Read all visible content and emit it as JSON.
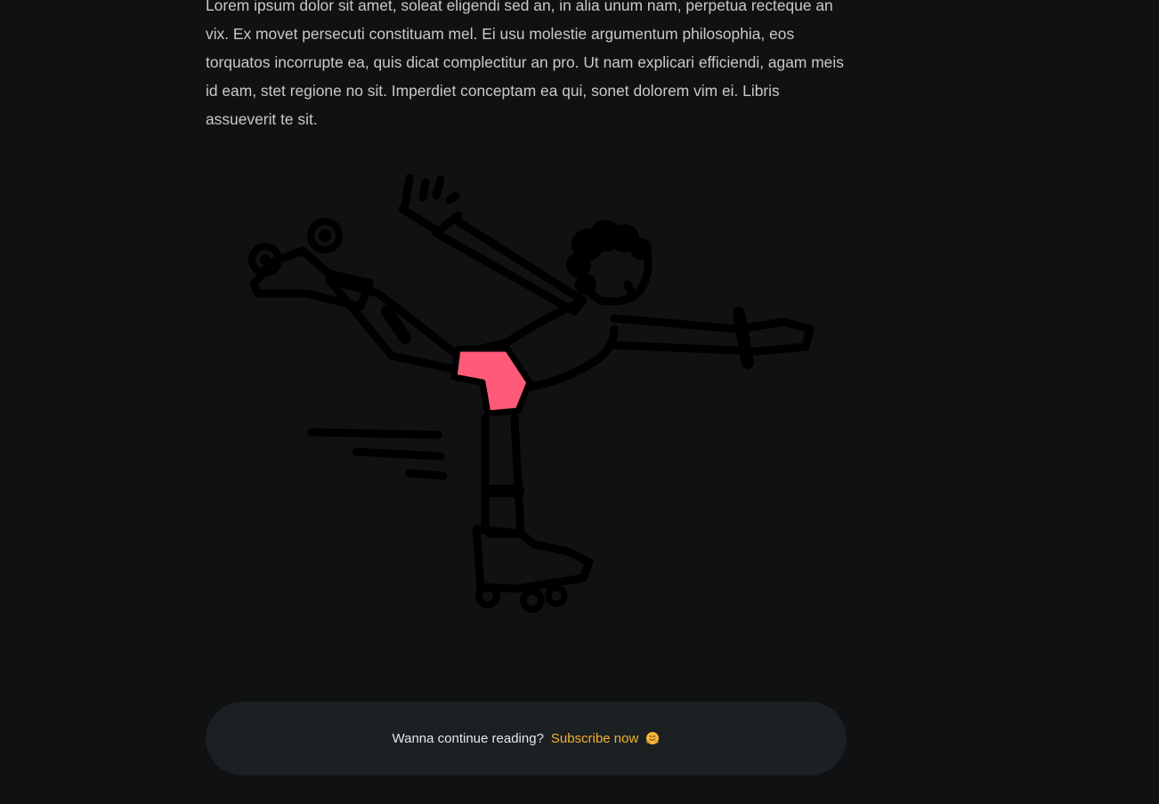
{
  "article": {
    "paragraph": "Lorem ipsum dolor sit amet, soleat eligendi sed an, in alia unum nam, perpetua recteque an vix. Ex movet persecuti constituam mel. Ei usu molestie argumentum philosophia, eos torquatos incorrupte ea, quis dicat complectitur an pro. Ut nam explicari efficiendi, agam meis id eam, stet regione no sit. Imperdiet conceptam ea qui, sonet dolorem vim ei. Libris assueverit te sit."
  },
  "illustration": {
    "subject": "roller-skater",
    "colors": {
      "ink": "#000000",
      "shorts": "#ff5a77"
    }
  },
  "cta": {
    "prompt": "Wanna continue reading?",
    "link_label": "Subscribe now",
    "emoji_icon": "hugging-face-icon",
    "colors": {
      "background": "#1b2022",
      "link": "#f2b230",
      "text": "#e6e7e8"
    }
  },
  "theme": {
    "background": "#101112",
    "body_text": "#c8c9cb"
  }
}
